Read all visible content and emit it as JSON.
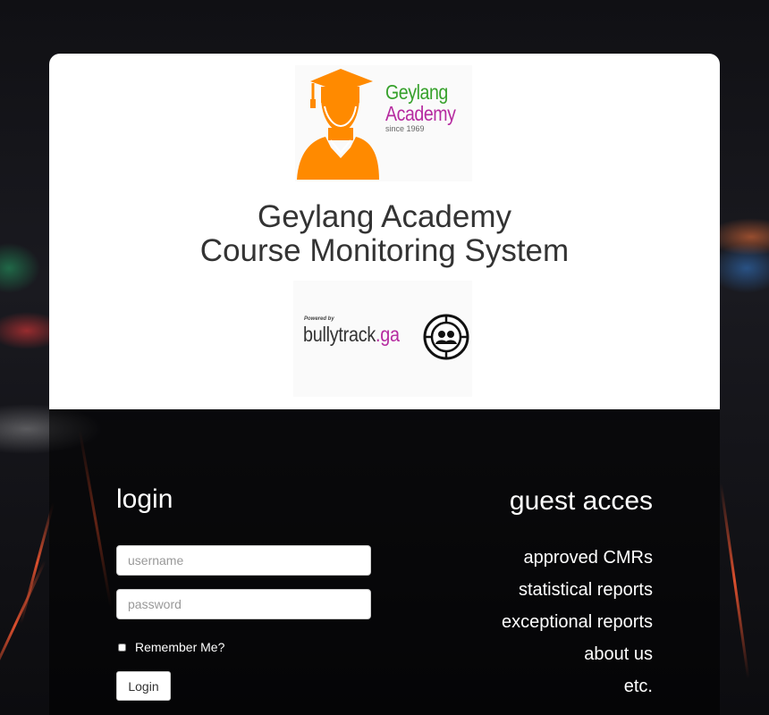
{
  "brand": {
    "name": "Geylang",
    "name2": "Academy",
    "since": "since 1969"
  },
  "title": {
    "line1": "Geylang Academy",
    "line2": "Course Monitoring System"
  },
  "powered": {
    "label": "Powered by",
    "name": "bullytrack",
    "tld": ".ga"
  },
  "login": {
    "heading": "login",
    "username_placeholder": "username",
    "password_placeholder": "password",
    "remember_label": "Remember Me?",
    "button_label": "Login"
  },
  "guest": {
    "heading": "guest acces",
    "links": [
      "approved CMRs",
      "statistical reports",
      "exceptional reports",
      "about us",
      "etc."
    ]
  },
  "colors": {
    "brand_green": "#36a12b",
    "brand_magenta": "#b62ba0",
    "brand_orange": "#ff8a00"
  },
  "icons": [
    "graduate-icon",
    "bullytrack-target-icon"
  ]
}
